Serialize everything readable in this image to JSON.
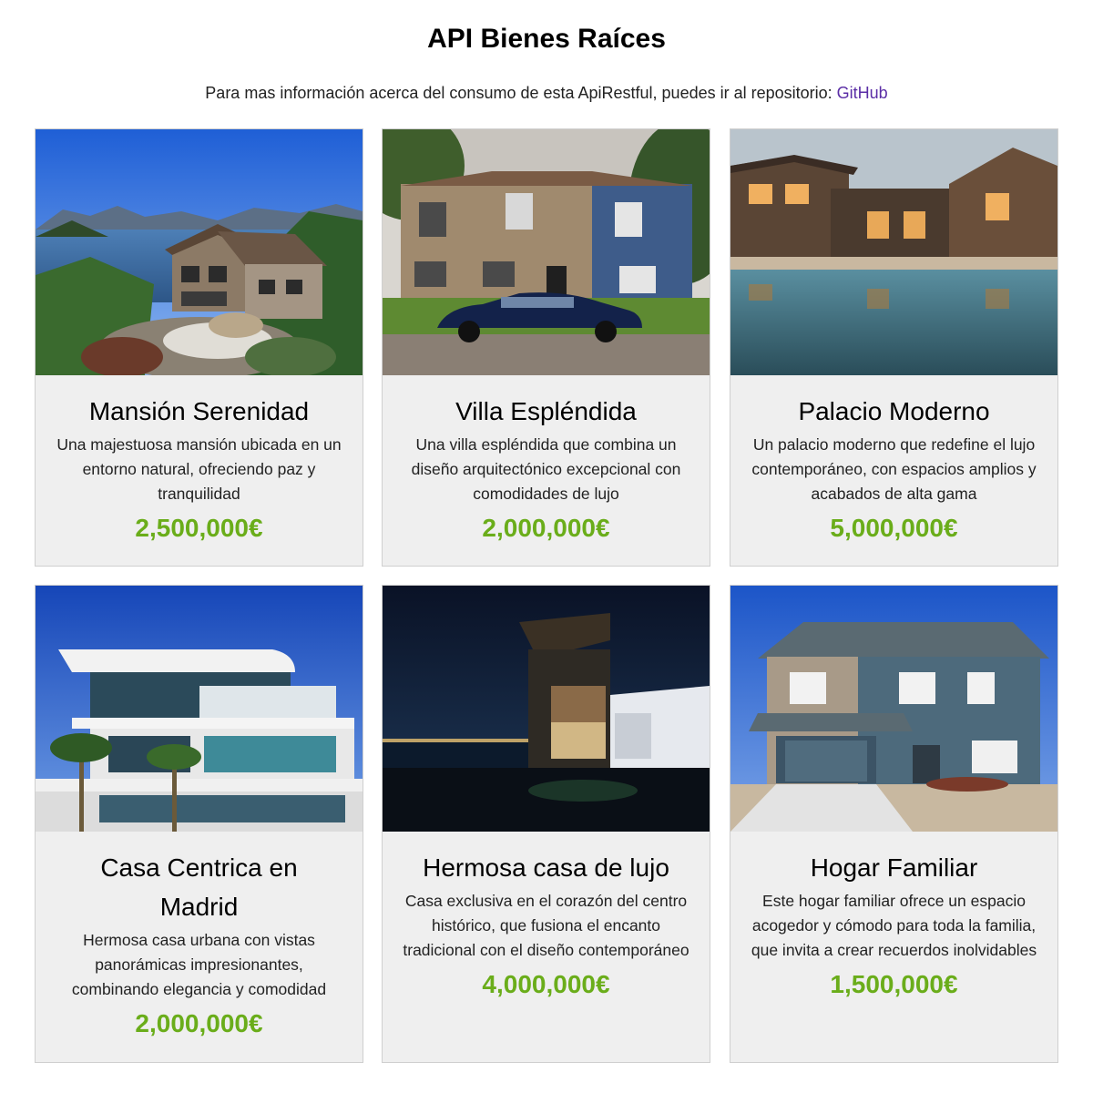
{
  "header": {
    "title": "API Bienes Raíces",
    "intro_text": "Para mas información acerca del consumo de esta ApiRestful, puedes ir al repositorio: ",
    "link_label": "GitHub"
  },
  "colors": {
    "price": "#6aad1a",
    "link": "#5b2ea6",
    "card_background": "#efefef"
  },
  "properties": [
    {
      "title": "Mansión Serenidad",
      "description": "Una majestuosa mansión ubicada en un entorno natural, ofreciendo paz y tranquilidad",
      "price": "2,500,000€",
      "image": "lakeside-mansion-photo"
    },
    {
      "title": "Villa Espléndida",
      "description": "Una villa espléndida que combina un diseño arquitectónico excepcional con comodidades de lujo",
      "price": "2,000,000€",
      "image": "brick-villa-with-car-photo"
    },
    {
      "title": "Palacio Moderno",
      "description": "Un palacio moderno que redefine el lujo contemporáneo, con espacios amplios y acabados de alta gama",
      "price": "5,000,000€",
      "image": "lodge-with-pool-photo"
    },
    {
      "title": "Casa Centrica en Madrid",
      "description": "Hermosa casa urbana con vistas panorámicas impresionantes, combinando elegancia y comodidad",
      "price": "2,000,000€",
      "image": "modern-white-house-photo"
    },
    {
      "title": "Hermosa casa de lujo",
      "description": "Casa exclusiva en el corazón del centro histórico, que fusiona el encanto tradicional con el diseño contemporáneo",
      "price": "4,000,000€",
      "image": "night-waterfront-house-photo"
    },
    {
      "title": "Hogar Familiar",
      "description": "Este hogar familiar ofrece un espacio acogedor y cómodo para toda la familia, que invita a crear recuerdos inolvidables",
      "price": "1,500,000€",
      "image": "suburban-family-home-photo"
    }
  ]
}
